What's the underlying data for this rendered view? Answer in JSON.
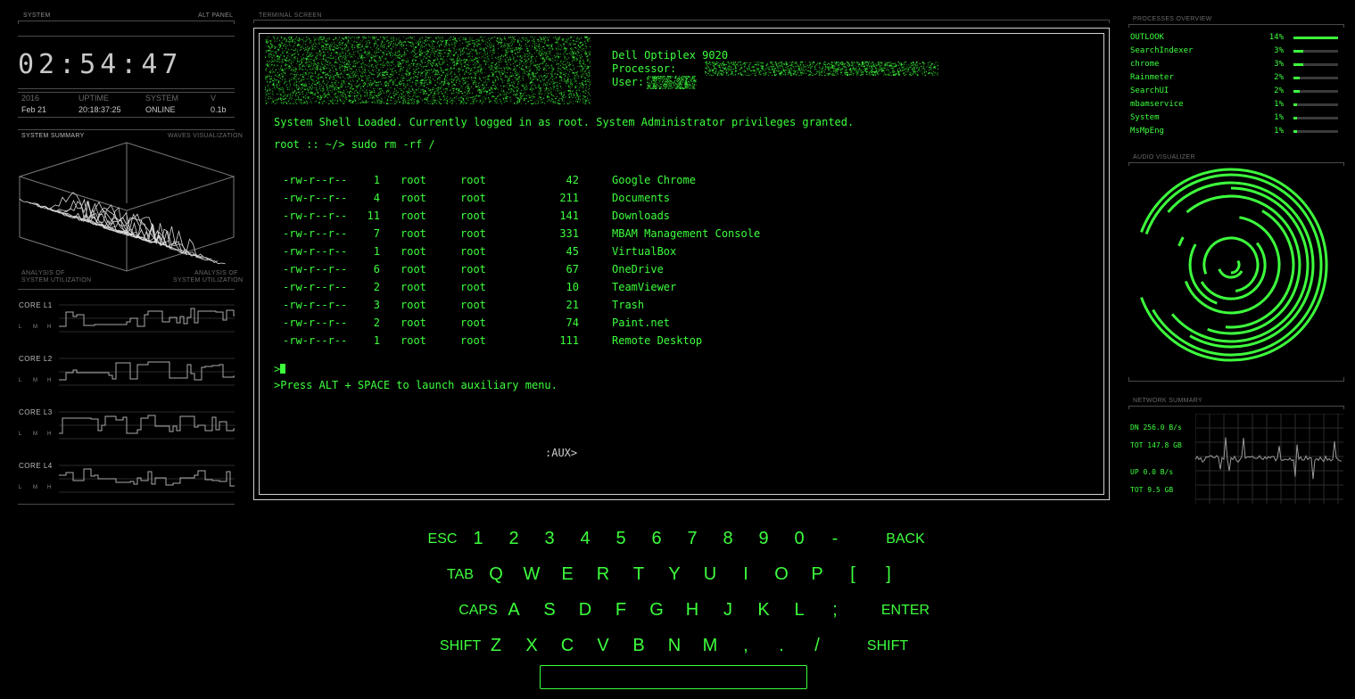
{
  "left": {
    "header_left": "SYSTEM",
    "header_right": "ALT PANEL",
    "clock": "02:54:47",
    "stats": [
      {
        "label": "2016",
        "value": "Feb 21"
      },
      {
        "label": "UPTIME",
        "value": "20:18:37:25"
      },
      {
        "label": "SYSTEM",
        "value": "ONLINE"
      },
      {
        "label": "V",
        "value": "0.1b"
      }
    ],
    "summary_left": "SYSTEM SUMMARY",
    "summary_right": "WAVES VISUALIZATION",
    "analysis_left_1": "ANALYSIS OF",
    "analysis_left_2": "SYSTEM UTILIZATION",
    "analysis_right_1": "ANALYSIS OF",
    "analysis_right_2": "SYSTEM UTILIZATION",
    "cores": [
      {
        "label": "CORE L1"
      },
      {
        "label": "CORE L2"
      },
      {
        "label": "CORE L3"
      },
      {
        "label": "CORE L4"
      }
    ],
    "lmh": [
      "L",
      "M",
      "H"
    ]
  },
  "terminal": {
    "header": "TERMINAL   SCREEN",
    "machine": "Dell Optiplex 9020",
    "processor_label": "Processor:",
    "user_label": "User:",
    "shell_msg": "System Shell Loaded. Currently logged in as root. System Administrator privileges granted.",
    "command": "root :: ~/> sudo rm -rf /",
    "files": [
      {
        "perm": "-rw-r--r--",
        "links": "1",
        "owner": "root",
        "group": "root",
        "size": "42",
        "name": "Google Chrome"
      },
      {
        "perm": "-rw-r--r--",
        "links": "4",
        "owner": "root",
        "group": "root",
        "size": "211",
        "name": "Documents"
      },
      {
        "perm": "-rw-r--r--",
        "links": "11",
        "owner": "root",
        "group": "root",
        "size": "141",
        "name": "Downloads"
      },
      {
        "perm": "-rw-r--r--",
        "links": "7",
        "owner": "root",
        "group": "root",
        "size": "331",
        "name": "MBAM Management Console"
      },
      {
        "perm": "-rw-r--r--",
        "links": "1",
        "owner": "root",
        "group": "root",
        "size": "45",
        "name": "VirtualBox"
      },
      {
        "perm": "-rw-r--r--",
        "links": "6",
        "owner": "root",
        "group": "root",
        "size": "67",
        "name": "OneDrive"
      },
      {
        "perm": "-rw-r--r--",
        "links": "2",
        "owner": "root",
        "group": "root",
        "size": "10",
        "name": "TeamViewer"
      },
      {
        "perm": "-rw-r--r--",
        "links": "3",
        "owner": "root",
        "group": "root",
        "size": "21",
        "name": "Trash"
      },
      {
        "perm": "-rw-r--r--",
        "links": "2",
        "owner": "root",
        "group": "root",
        "size": "74",
        "name": "Paint.net"
      },
      {
        "perm": "-rw-r--r--",
        "links": "1",
        "owner": "root",
        "group": "root",
        "size": "111",
        "name": "Remote Desktop"
      }
    ],
    "prompt": ">",
    "hint": ">Press ALT + SPACE to launch auxiliary menu.",
    "aux": ":AUX>"
  },
  "keyboard": {
    "rows": [
      [
        "ESC",
        "1",
        "2",
        "3",
        "4",
        "5",
        "6",
        "7",
        "8",
        "9",
        "0",
        "-",
        "BACK"
      ],
      [
        "TAB",
        "Q",
        "W",
        "E",
        "R",
        "T",
        "Y",
        "U",
        "I",
        "O",
        "P",
        "[",
        "]"
      ],
      [
        "CAPS",
        "A",
        "S",
        "D",
        "F",
        "G",
        "H",
        "J",
        "K",
        "L",
        ";",
        "ENTER"
      ],
      [
        "SHIFT",
        "Z",
        "X",
        "C",
        "V",
        "B",
        "N",
        "M",
        ",",
        ".",
        "/",
        "SHIFT"
      ]
    ]
  },
  "right": {
    "proc_header": "PROCESSES   OVERVIEW",
    "processes": [
      {
        "name": "OUTLOOK",
        "pct": "14%",
        "fill": 1.0
      },
      {
        "name": "SearchIndexer",
        "pct": "3%",
        "fill": 0.22
      },
      {
        "name": "chrome",
        "pct": "3%",
        "fill": 0.22
      },
      {
        "name": "Rainmeter",
        "pct": "2%",
        "fill": 0.14
      },
      {
        "name": "SearchUI",
        "pct": "2%",
        "fill": 0.14
      },
      {
        "name": "mbamservice",
        "pct": "1%",
        "fill": 0.07
      },
      {
        "name": "System",
        "pct": "1%",
        "fill": 0.07
      },
      {
        "name": "MsMpEng",
        "pct": "1%",
        "fill": 0.07
      }
    ],
    "audio_header": "AUDIO   VISUALIZER",
    "net_header": "NETWORK   SUMMARY",
    "net_down": "DN 256.0 B/s",
    "net_down_total": "TOT 147.8 GB",
    "net_up": "UP 0.0 B/s",
    "net_up_total": "TOT 9.5 GB"
  },
  "colors": {
    "accent": "#3dff3d",
    "frame": "#cfcfcf",
    "muted": "#5a5a5a"
  }
}
